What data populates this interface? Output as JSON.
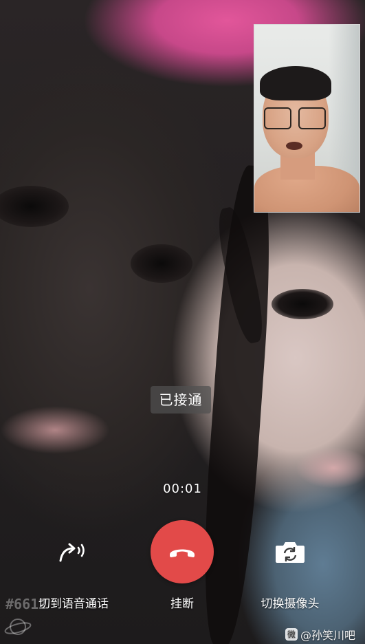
{
  "call": {
    "status": "已接通",
    "duration": "00:01"
  },
  "controls": {
    "voice_label": "切到语音通话",
    "hangup_label": "挂断",
    "switch_camera_label": "切换摄像头",
    "hangup_color": "#e24a49"
  },
  "icons": {
    "voice": "switch-to-voice-icon",
    "hangup": "phone-hangup-icon",
    "switch_camera": "camera-switch-icon"
  },
  "watermark": {
    "left_tag": "#6612",
    "right_text": "@孙笑川吧"
  }
}
